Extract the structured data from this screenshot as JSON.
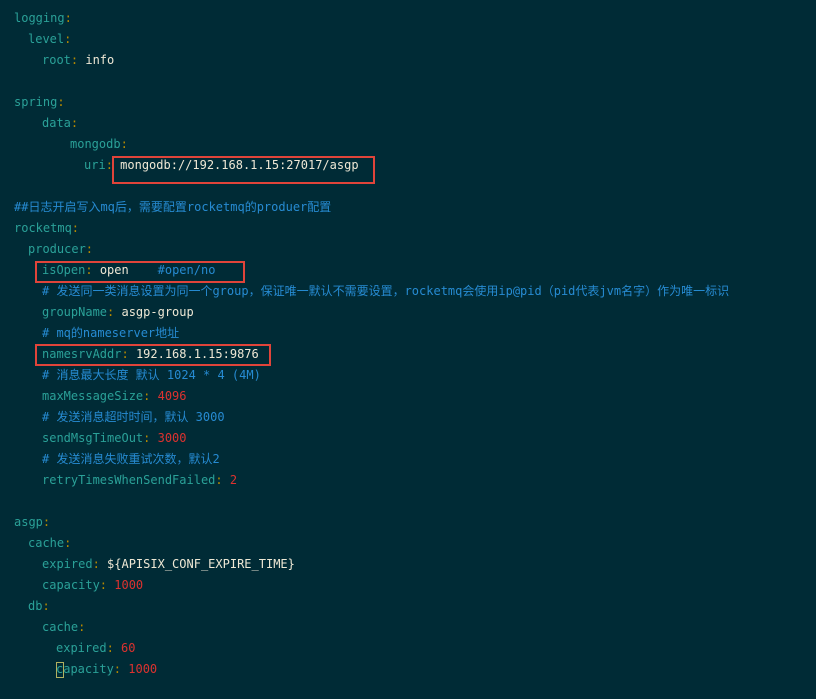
{
  "editor": {
    "language": "yaml",
    "lines": [
      {
        "k": "logging",
        "v": ""
      },
      {
        "k": "level",
        "v": ""
      },
      {
        "k": "root",
        "v": "info"
      },
      {
        "blank": true
      },
      {
        "k": "spring",
        "v": ""
      },
      {
        "k": "data",
        "v": ""
      },
      {
        "k": "mongodb",
        "v": ""
      },
      {
        "k": "uri",
        "v": "mongodb://192.168.1.15:27017/asgp"
      },
      {
        "blank": true
      },
      {
        "c": "##日志开启写入mq后，需要配置rocketmq的produer配置"
      },
      {
        "k": "rocketmq",
        "v": ""
      },
      {
        "k": "producer",
        "v": ""
      },
      {
        "k": "isOpen",
        "v": "open",
        "trail": "#open/no"
      },
      {
        "c": "# 发送同一类消息设置为同一个group，保证唯一默认不需要设置，rocketmq会使用ip@pid（pid代表jvm名字）作为唯一标识"
      },
      {
        "k": "groupName",
        "v": "asgp-group"
      },
      {
        "c": "# mq的nameserver地址"
      },
      {
        "k": "namesrvAddr",
        "v": "192.168.1.15:9876"
      },
      {
        "c": "# 消息最大长度 默认 1024 * 4 (4M)"
      },
      {
        "k": "maxMessageSize",
        "v": "4096"
      },
      {
        "c": "# 发送消息超时时间，默认 3000"
      },
      {
        "k": "sendMsgTimeOut",
        "v": "3000"
      },
      {
        "c": "# 发送消息失败重试次数，默认2"
      },
      {
        "k": "retryTimesWhenSendFailed",
        "v": "2"
      },
      {
        "blank": true
      },
      {
        "k": "asgp",
        "v": ""
      },
      {
        "k": "cache",
        "v": ""
      },
      {
        "k": "expired",
        "v": "${APISIX_CONF_EXPIRE_TIME}"
      },
      {
        "k": "capacity",
        "v": "1000"
      },
      {
        "k": "db",
        "v": ""
      },
      {
        "k": "cache",
        "v": ""
      },
      {
        "k": "expired",
        "v": "60"
      },
      {
        "k": "capacity",
        "v": "1000"
      }
    ]
  }
}
